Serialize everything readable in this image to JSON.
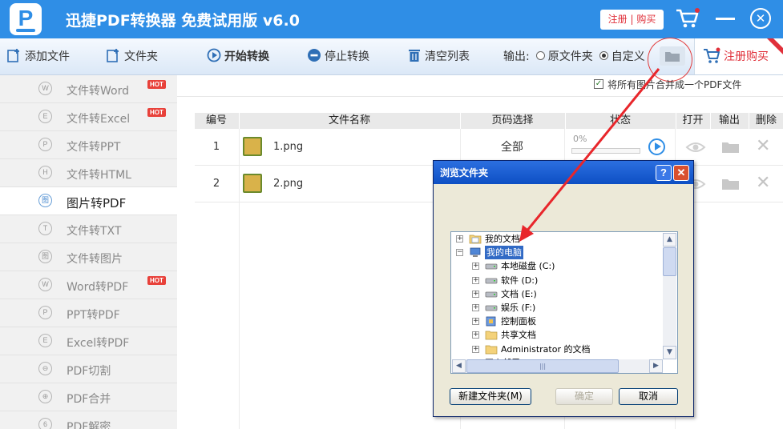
{
  "app": {
    "title": "迅捷PDF转换器 免费试用版 v6.0",
    "logo_letter": "P",
    "register_button": "注册 | 购买",
    "close_glyph": "✕"
  },
  "toolbar": {
    "add_file": "添加文件",
    "add_folder": "文件夹",
    "start_convert": "开始转换",
    "stop_convert": "停止转换",
    "clear_list": "清空列表",
    "output_label": "输出:",
    "option_original": "原文件夹",
    "option_custom": "自定义",
    "selected_option": "自定义",
    "buy": "注册购买"
  },
  "sidebar": {
    "items": [
      {
        "label": "文件转Word",
        "icon": "W",
        "hot": true
      },
      {
        "label": "文件转Excel",
        "icon": "E",
        "hot": true
      },
      {
        "label": "文件转PPT",
        "icon": "P",
        "hot": false
      },
      {
        "label": "文件转HTML",
        "icon": "H",
        "hot": false
      },
      {
        "label": "图片转PDF",
        "icon": "图",
        "hot": false,
        "active": true
      },
      {
        "label": "文件转TXT",
        "icon": "T",
        "hot": false
      },
      {
        "label": "文件转图片",
        "icon": "图",
        "hot": false
      },
      {
        "label": "Word转PDF",
        "icon": "W",
        "hot": true
      },
      {
        "label": "PPT转PDF",
        "icon": "P",
        "hot": false
      },
      {
        "label": "Excel转PDF",
        "icon": "E",
        "hot": false
      },
      {
        "label": "PDF切割",
        "icon": "⊖",
        "hot": false
      },
      {
        "label": "PDF合并",
        "icon": "⊕",
        "hot": false
      },
      {
        "label": "PDF解密",
        "icon": "6",
        "hot": false
      }
    ],
    "hot_badge": "HOT"
  },
  "main": {
    "merge_checkbox_label": "将所有图片合并成一个PDF文件",
    "merge_checked": true,
    "columns": [
      "编号",
      "文件名称",
      "页码选择",
      "状态",
      "打开",
      "输出",
      "删除"
    ],
    "rows": [
      {
        "index": "1",
        "filename": "1.png",
        "pages": "全部",
        "progress": "0%"
      },
      {
        "index": "2",
        "filename": "2.png",
        "pages": "",
        "progress": ""
      }
    ]
  },
  "dialog": {
    "title": "浏览文件夹",
    "help_glyph": "?",
    "close_glyph": "✕",
    "tree": [
      {
        "label": "我的文档",
        "level": 0,
        "expander": "+",
        "icon": "documents-icon"
      },
      {
        "label": "我的电脑",
        "level": 0,
        "expander": "−",
        "icon": "computer-icon",
        "selected": true
      },
      {
        "label": "本地磁盘 (C:)",
        "level": 1,
        "expander": "+",
        "icon": "drive-icon"
      },
      {
        "label": "软件 (D:)",
        "level": 1,
        "expander": "+",
        "icon": "drive-icon"
      },
      {
        "label": "文档 (E:)",
        "level": 1,
        "expander": "+",
        "icon": "drive-icon"
      },
      {
        "label": "娱乐 (F:)",
        "level": 1,
        "expander": "+",
        "icon": "drive-icon"
      },
      {
        "label": "控制面板",
        "level": 1,
        "expander": "+",
        "icon": "control-panel-icon"
      },
      {
        "label": "共享文档",
        "level": 1,
        "expander": "+",
        "icon": "folder-icon"
      },
      {
        "label": "Administrator 的文档",
        "level": 1,
        "expander": "+",
        "icon": "folder-icon"
      },
      {
        "label": "网上邻居",
        "level": 0,
        "expander": "+",
        "icon": "network-icon"
      }
    ],
    "new_folder": "新建文件夹(M)",
    "ok": "确定",
    "cancel": "取消",
    "scroll_up": "▲",
    "scroll_down": "▼",
    "scroll_left": "◀",
    "scroll_right": "▶"
  },
  "colors": {
    "brand_blue": "#2f8ee6",
    "accent_red": "#e0303a",
    "annotation_red": "#e23a3a"
  }
}
